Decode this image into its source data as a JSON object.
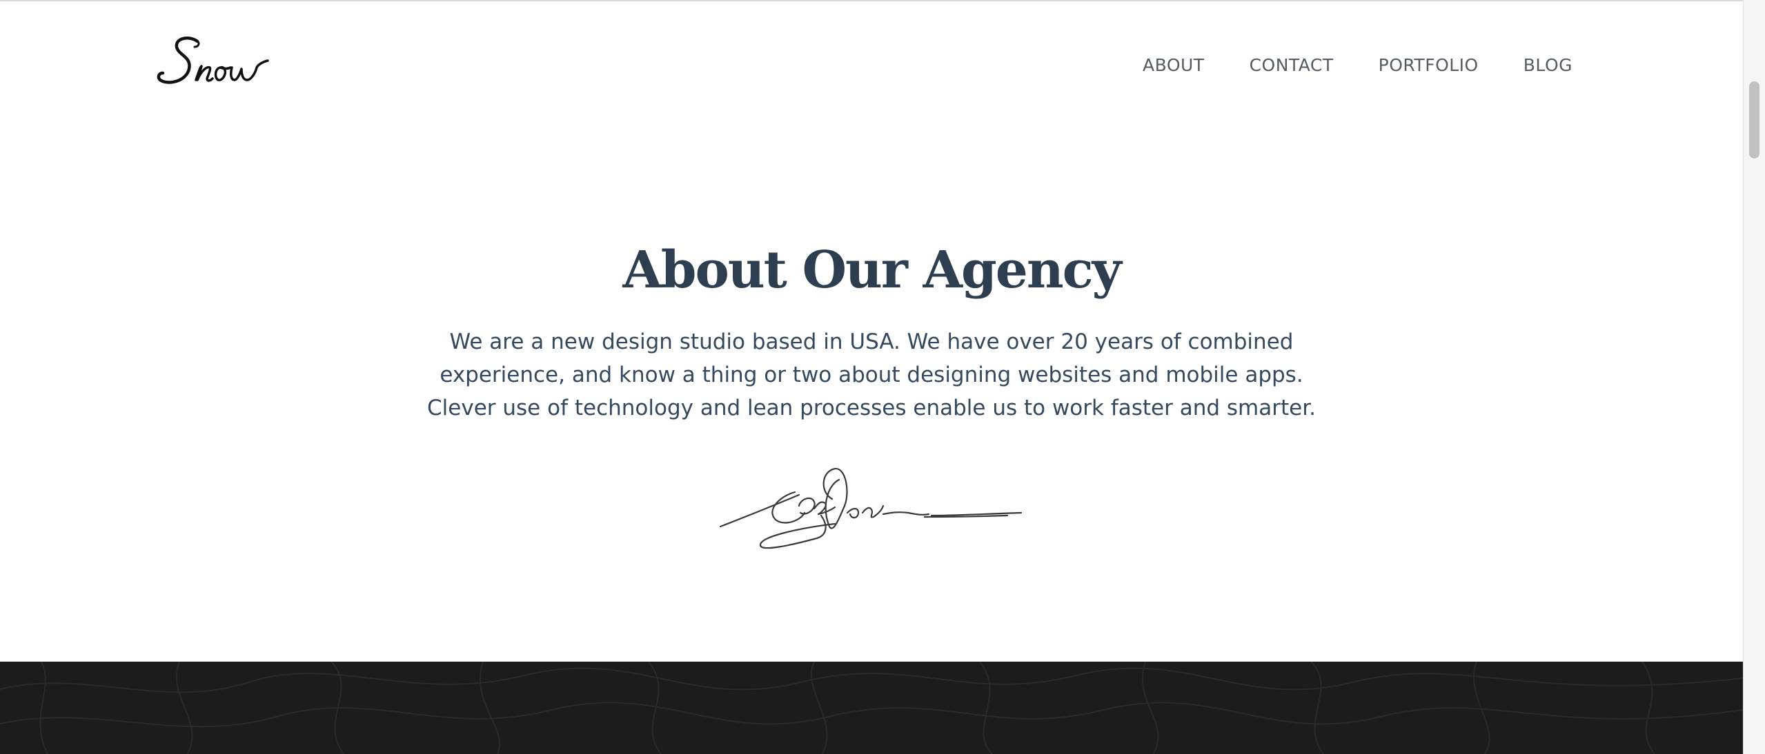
{
  "header": {
    "logo_text": "Snow",
    "nav": [
      {
        "label": "ABOUT"
      },
      {
        "label": "CONTACT"
      },
      {
        "label": "PORTFOLIO"
      },
      {
        "label": "BLOG"
      }
    ]
  },
  "about": {
    "title": "About Our Agency",
    "body": "We are a new design studio based in USA. We have over 20 years of combined experience, and know a thing or two about designing websites and mobile apps. Clever use of technology and lean processes enable us to work faster and smarter."
  },
  "colors": {
    "heading": "#2c3e50",
    "body_text": "#34495e",
    "nav_text": "#555b61",
    "dark_band": "#1c1c1c"
  },
  "icons": {
    "logo": "snow-script-logo",
    "signature": "handwritten-signature"
  }
}
